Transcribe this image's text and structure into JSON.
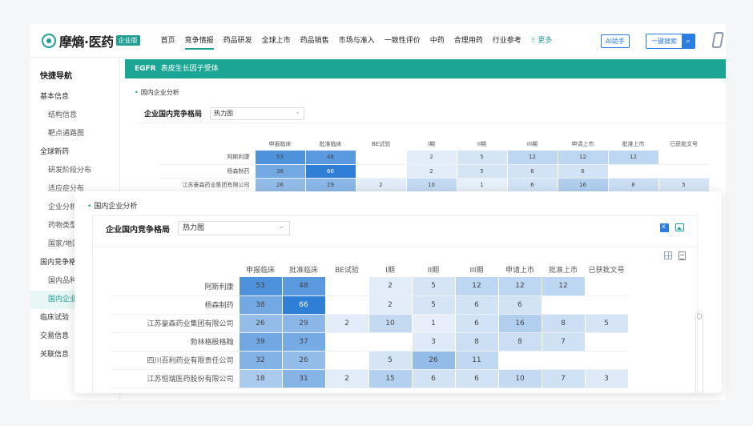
{
  "nav": {
    "logo_text": "摩熵·医药",
    "logo_badge": "企业版",
    "menu": [
      "首页",
      "竞争情报",
      "药品研发",
      "全球上市",
      "药品销售",
      "市场与准入",
      "一致性评价",
      "中药",
      "合理用药",
      "行业参考",
      "更多"
    ],
    "active_index": 1,
    "ai_label": "AI助手",
    "search_label": "一键搜索"
  },
  "sidebar": {
    "title": "快捷导航",
    "items": [
      {
        "label": "基本信息",
        "sub": false
      },
      {
        "label": "结构信息",
        "sub": true
      },
      {
        "label": "靶点通路图",
        "sub": true
      },
      {
        "label": "全球新药",
        "sub": false
      },
      {
        "label": "研发阶段分布",
        "sub": true
      },
      {
        "label": "适应症分布",
        "sub": true
      },
      {
        "label": "企业分析",
        "sub": true
      },
      {
        "label": "药物类型",
        "sub": true
      },
      {
        "label": "国家/地区",
        "sub": true
      },
      {
        "label": "国内竞争格局",
        "sub": false
      },
      {
        "label": "国内品种",
        "sub": true
      },
      {
        "label": "国内企业",
        "sub": true,
        "active": true
      },
      {
        "label": "临床试验",
        "sub": false
      },
      {
        "label": "交易信息",
        "sub": false
      },
      {
        "label": "关联信息",
        "sub": false
      }
    ]
  },
  "page": {
    "banner_code": "EGFR",
    "banner_name": "表皮生长因子受体",
    "section_title": "国内企业分析",
    "card_title": "企业国内竞争格局",
    "view_select": "热力图"
  },
  "heatmap": {
    "columns": [
      "申报临床",
      "批准临床",
      "BE试验",
      "I期",
      "II期",
      "III期",
      "申请上市",
      "批准上市",
      "已获批文号"
    ],
    "rows": [
      {
        "company": "阿斯利康",
        "values": [
          53,
          48,
          null,
          2,
          5,
          12,
          12,
          12,
          null
        ]
      },
      {
        "company": "杨森制药",
        "values": [
          38,
          66,
          null,
          2,
          5,
          6,
          6,
          null,
          null
        ]
      },
      {
        "company": "江苏豪森药业集团有限公司",
        "values": [
          26,
          29,
          2,
          10,
          1,
          6,
          16,
          8,
          5
        ]
      },
      {
        "company": "勃林格殷格翰",
        "values": [
          39,
          37,
          null,
          null,
          3,
          8,
          8,
          7,
          null
        ]
      },
      {
        "company": "四川百利药业有限责任公司",
        "values": [
          32,
          26,
          null,
          5,
          26,
          11,
          null,
          null,
          null
        ]
      },
      {
        "company": "江苏恒瑞医药股份有限公司",
        "values": [
          18,
          31,
          2,
          15,
          6,
          6,
          10,
          7,
          3
        ]
      }
    ],
    "max": 66,
    "colors": {
      "low": "#eef4fb",
      "high": "#2f7fd6"
    }
  }
}
